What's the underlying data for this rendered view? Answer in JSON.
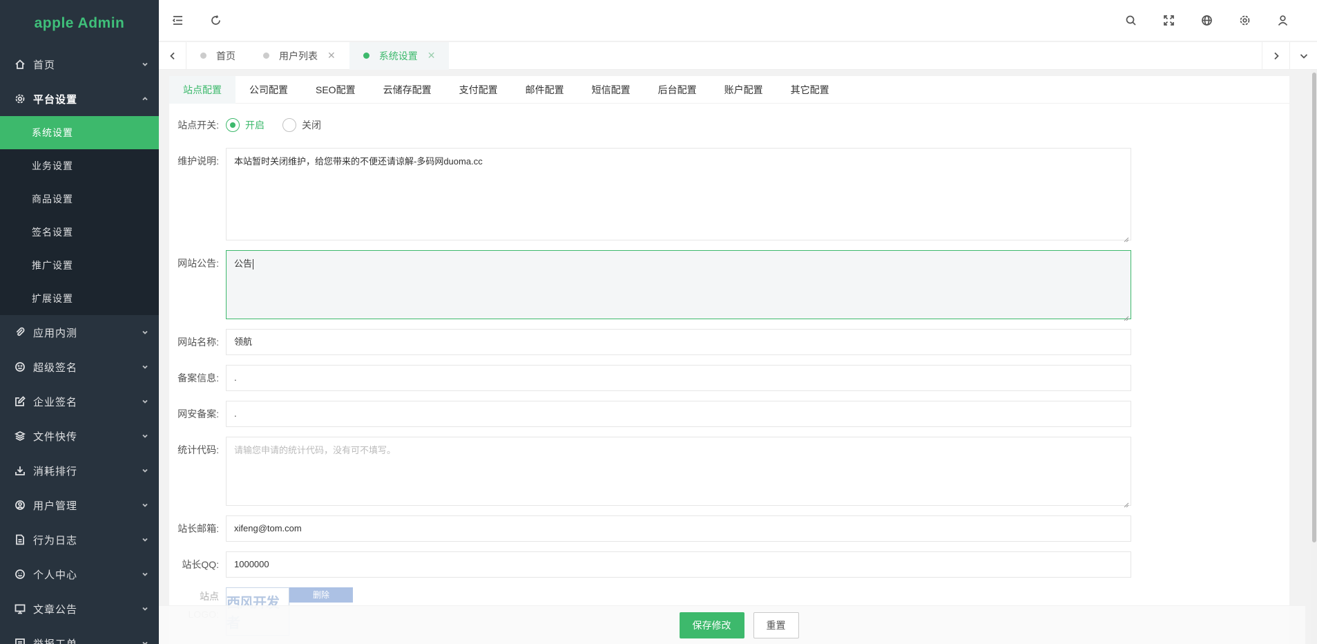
{
  "app": {
    "title": "apple Admin"
  },
  "sidebar": {
    "items": [
      {
        "label": "首页",
        "icon": "home-icon",
        "open": false
      },
      {
        "label": "平台设置",
        "icon": "gear-icon",
        "open": true,
        "children": [
          "系统设置",
          "业务设置",
          "商品设置",
          "签名设置",
          "推广设置",
          "扩展设置"
        ],
        "active_child": "系统设置"
      },
      {
        "label": "应用内测",
        "icon": "paperclip-icon",
        "open": false
      },
      {
        "label": "超级签名",
        "icon": "smile-icon",
        "open": false
      },
      {
        "label": "企业签名",
        "icon": "edit-icon",
        "open": false
      },
      {
        "label": "文件快传",
        "icon": "layers-icon",
        "open": false
      },
      {
        "label": "消耗排行",
        "icon": "download-icon",
        "open": false
      },
      {
        "label": "用户管理",
        "icon": "user-circle-icon",
        "open": false
      },
      {
        "label": "行为日志",
        "icon": "file-icon",
        "open": false
      },
      {
        "label": "个人中心",
        "icon": "face-icon",
        "open": false
      },
      {
        "label": "文章公告",
        "icon": "monitor-icon",
        "open": false
      },
      {
        "label": "举报工单",
        "icon": "ticket-icon",
        "open": false
      }
    ]
  },
  "header": {
    "left_icons": [
      "menu-fold-icon",
      "refresh-icon"
    ],
    "right_icons": [
      "search-icon",
      "fullscreen-icon",
      "globe-icon",
      "settings-icon",
      "user-icon"
    ]
  },
  "page_tabs": [
    {
      "label": "首页",
      "closable": false,
      "active": false
    },
    {
      "label": "用户列表",
      "closable": true,
      "active": false
    },
    {
      "label": "系统设置",
      "closable": true,
      "active": true
    }
  ],
  "config_tabs": [
    "站点配置",
    "公司配置",
    "SEO配置",
    "云储存配置",
    "支付配置",
    "邮件配置",
    "短信配置",
    "后台配置",
    "账户配置",
    "其它配置"
  ],
  "active_config_tab": "站点配置",
  "form": {
    "site_switch": {
      "label": "站点开关:",
      "options": [
        "开启",
        "关闭"
      ],
      "selected": "开启"
    },
    "maintenance": {
      "label": "维护说明:",
      "value": "本站暂时关闭维护，给您带来的不便还请谅解-多码网duoma.cc"
    },
    "notice": {
      "label": "网站公告:",
      "value": "公告"
    },
    "site_name": {
      "label": "网站名称:",
      "value": "领航"
    },
    "icp": {
      "label": "备案信息:",
      "value": "."
    },
    "police": {
      "label": "网安备案:",
      "value": "."
    },
    "stats_code": {
      "label": "统计代码:",
      "value": "",
      "placeholder": "请输您申请的统计代码，没有可不填写。"
    },
    "email": {
      "label": "站长邮箱:",
      "value": "xifeng@tom.com"
    },
    "qq": {
      "label": "站长QQ:",
      "value": "1000000"
    },
    "logo": {
      "label": "站点LOGO:",
      "image_text": "西风开发者",
      "delete_label": "删除"
    }
  },
  "actions": {
    "save": "保存修改",
    "reset": "重置"
  },
  "colors": {
    "accent": "#3db96c",
    "sidebar_bg": "#28333e",
    "submenu_bg": "#1c252e"
  }
}
